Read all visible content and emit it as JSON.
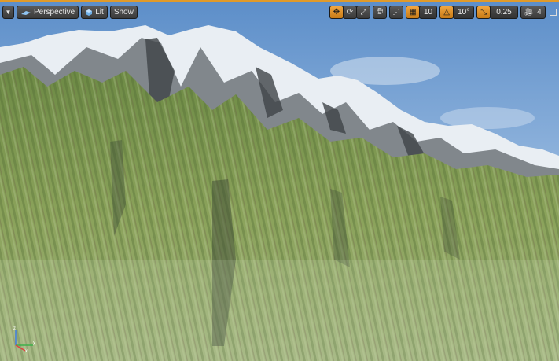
{
  "toolbar_left": {
    "menu_icon": "chevron-down-icon",
    "perspective_label": "Perspective",
    "lit_label": "Lit",
    "show_label": "Show"
  },
  "toolbar_right": {
    "grid_snap_value": "10",
    "rotation_snap_value": "10°",
    "scale_snap_value": "0.25",
    "camera_speed_value": "4"
  },
  "colors": {
    "accent": "#e09a2a",
    "sky_top": "#5f8fc8",
    "sky_bottom": "#b8cfe6",
    "grass": "#7f9a4e",
    "rock": "#6b6f74",
    "snow": "#eef2f6"
  }
}
